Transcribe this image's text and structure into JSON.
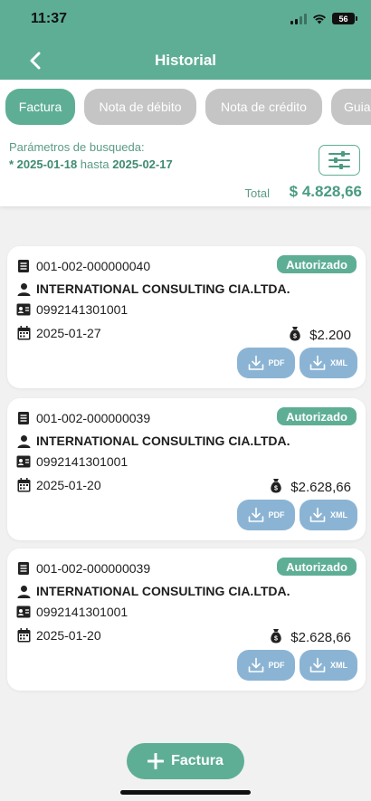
{
  "status_bar": {
    "time": "11:37",
    "battery": "56"
  },
  "header": {
    "title": "Historial"
  },
  "tabs": [
    {
      "label": "Factura",
      "active": true
    },
    {
      "label": "Nota de débito",
      "active": false
    },
    {
      "label": "Nota de crédito",
      "active": false
    },
    {
      "label": "Guia",
      "active": false
    }
  ],
  "search": {
    "label": "Parámetros de busqueda:",
    "prefix": "* ",
    "from": "2025-01-18",
    "to_word": " hasta ",
    "to": "2025-02-17",
    "total_label": "Total",
    "total_value": "$ 4.828,66"
  },
  "invoices": [
    {
      "number": "001-002-000000040",
      "client": "INTERNATIONAL CONSULTING CIA.LTDA.",
      "ruc": "0992141301001",
      "date": "2025-01-27",
      "amount": "$2.200",
      "status": "Autorizado",
      "pdf_label": "PDF",
      "xml_label": "XML"
    },
    {
      "number": "001-002-000000039",
      "client": "INTERNATIONAL CONSULTING CIA.LTDA.",
      "ruc": "0992141301001",
      "date": "2025-01-20",
      "amount": "$2.628,66",
      "status": "Autorizado",
      "pdf_label": "PDF",
      "xml_label": "XML"
    },
    {
      "number": "001-002-000000039",
      "client": "INTERNATIONAL CONSULTING CIA.LTDA.",
      "ruc": "0992141301001",
      "date": "2025-01-20",
      "amount": "$2.628,66",
      "status": "Autorizado",
      "pdf_label": "PDF",
      "xml_label": "XML"
    }
  ],
  "fab": {
    "label": "Factura"
  },
  "colors": {
    "primary": "#5eae95",
    "tab_inactive": "#c5c5c5",
    "download_button": "#8bb4d4",
    "background": "#f1f1f1"
  }
}
